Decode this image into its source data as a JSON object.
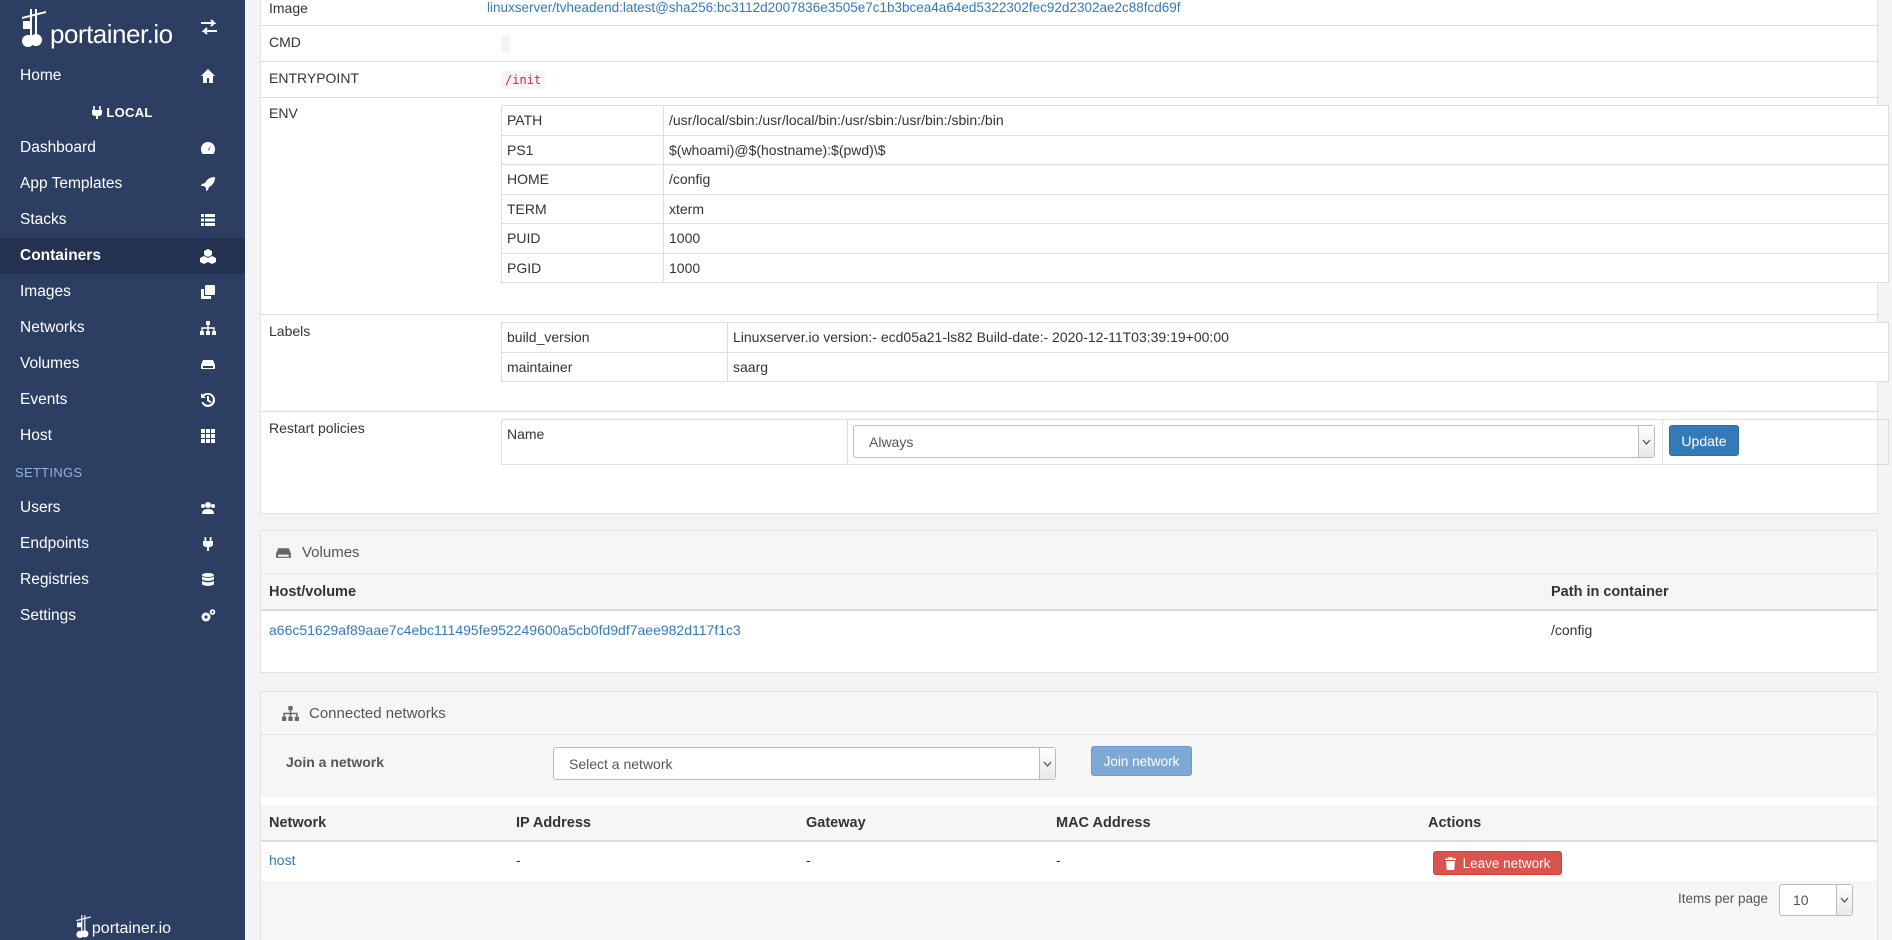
{
  "brand": {
    "name": "portainer.io",
    "footer": "portainer.io"
  },
  "sidebar": {
    "home": "Home",
    "endpoint": "LOCAL",
    "items": [
      {
        "label": "Dashboard",
        "icon": "tachometer-icon"
      },
      {
        "label": "App Templates",
        "icon": "rocket-icon"
      },
      {
        "label": "Stacks",
        "icon": "list-icon"
      },
      {
        "label": "Containers",
        "icon": "cubes-icon"
      },
      {
        "label": "Images",
        "icon": "clone-icon"
      },
      {
        "label": "Networks",
        "icon": "sitemap-icon"
      },
      {
        "label": "Volumes",
        "icon": "hdd-icon"
      },
      {
        "label": "Events",
        "icon": "history-icon"
      },
      {
        "label": "Host",
        "icon": "th-icon"
      }
    ],
    "settings_heading": "SETTINGS",
    "settings_items": [
      {
        "label": "Users",
        "icon": "users-icon"
      },
      {
        "label": "Endpoints",
        "icon": "plug-icon"
      },
      {
        "label": "Registries",
        "icon": "database-icon"
      },
      {
        "label": "Settings",
        "icon": "cogs-icon"
      }
    ]
  },
  "details": {
    "image_label": "Image",
    "image_value": "linuxserver/tvheadend:latest@sha256:bc3112d2007836e3505e7c1b3bcea4a64ed5322302fec92d2302ae2c88fcd69f",
    "cmd_label": "CMD",
    "entrypoint_label": "ENTRYPOINT",
    "entrypoint_value": "/init",
    "env_label": "ENV",
    "env": [
      {
        "key": "PATH",
        "value": "/usr/local/sbin:/usr/local/bin:/usr/sbin:/usr/bin:/sbin:/bin"
      },
      {
        "key": "PS1",
        "value": "$(whoami)@$(hostname):$(pwd)\\$"
      },
      {
        "key": "HOME",
        "value": "/config"
      },
      {
        "key": "TERM",
        "value": "xterm"
      },
      {
        "key": "PUID",
        "value": "1000"
      },
      {
        "key": "PGID",
        "value": "1000"
      }
    ],
    "labels_label": "Labels",
    "labels": [
      {
        "key": "build_version",
        "value": "Linuxserver.io version:- ecd05a21-ls82 Build-date:- 2020-12-11T03:39:19+00:00"
      },
      {
        "key": "maintainer",
        "value": "saarg"
      }
    ],
    "restart_label": "Restart policies",
    "restart_name_label": "Name",
    "restart_value": "Always",
    "update_button": "Update"
  },
  "volumes": {
    "title": "Volumes",
    "col_host": "Host/volume",
    "col_path": "Path in container",
    "rows": [
      {
        "host": "a66c51629af89aae7c4ebc111495fe952249600a5cb0fd9df7aee982d117f1c3",
        "path": "/config"
      }
    ]
  },
  "networks": {
    "title": "Connected networks",
    "join_label": "Join a network",
    "select_placeholder": "Select a network",
    "join_button": "Join network",
    "columns": {
      "network": "Network",
      "ip": "IP Address",
      "gateway": "Gateway",
      "mac": "MAC Address",
      "actions": "Actions"
    },
    "rows": [
      {
        "network": "host",
        "ip": "-",
        "gateway": "-",
        "mac": "-",
        "action": "Leave network"
      }
    ],
    "items_per_page_label": "Items per page",
    "items_per_page": "10"
  },
  "colors": {
    "sidebar": "#2d3e63",
    "primary": "#337ab7",
    "danger": "#d9534f"
  }
}
